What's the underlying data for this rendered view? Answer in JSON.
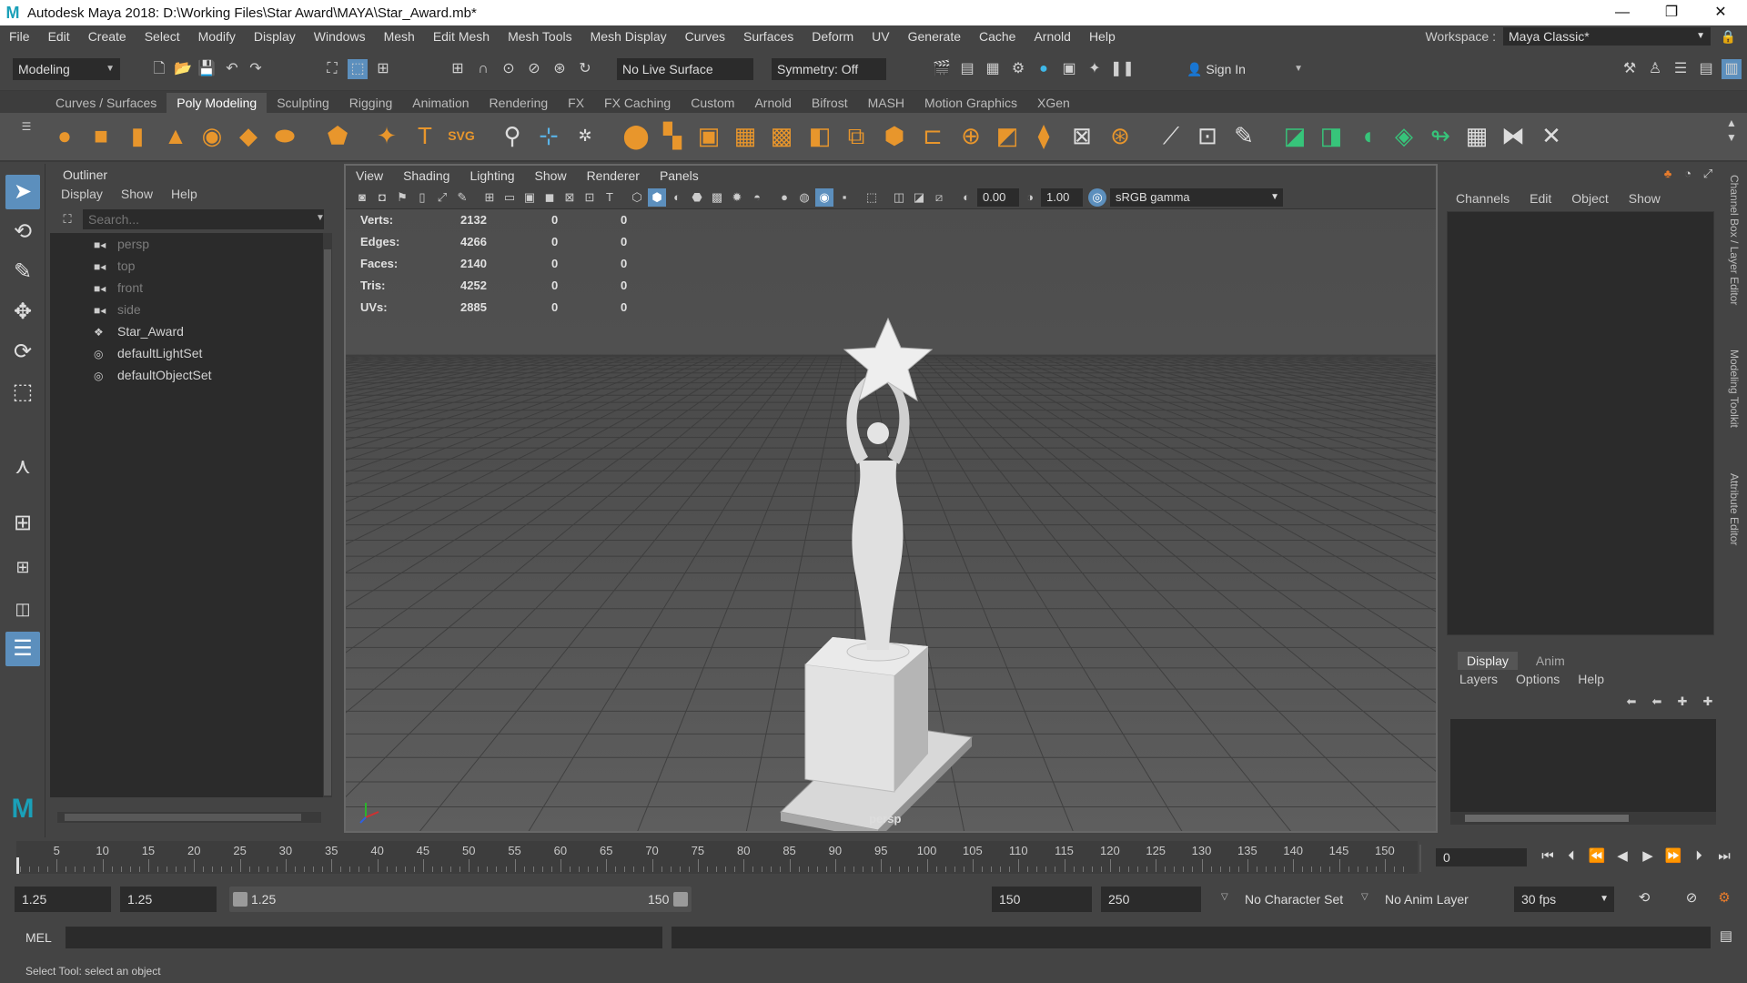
{
  "window": {
    "title": "Autodesk Maya 2018: D:\\Working Files\\Star Award\\MAYA\\Star_Award.mb*",
    "minimize": "—",
    "restore": "❐",
    "close": "✕"
  },
  "menubar": {
    "items": [
      "File",
      "Edit",
      "Create",
      "Select",
      "Modify",
      "Display",
      "Windows",
      "Mesh",
      "Edit Mesh",
      "Mesh Tools",
      "Mesh Display",
      "Curves",
      "Surfaces",
      "Deform",
      "UV",
      "Generate",
      "Cache",
      "Arnold",
      "Help"
    ],
    "workspace_label": "Workspace :",
    "workspace_value": "Maya Classic*"
  },
  "statusline": {
    "menuset": "Modeling",
    "live_surface": "No Live Surface",
    "symmetry": "Symmetry: Off",
    "sign_in": "Sign In"
  },
  "shelf": {
    "tabs": [
      "Curves / Surfaces",
      "Poly Modeling",
      "Sculpting",
      "Rigging",
      "Animation",
      "Rendering",
      "FX",
      "FX Caching",
      "Custom",
      "Arnold",
      "Bifrost",
      "MASH",
      "Motion Graphics",
      "XGen"
    ],
    "active_tab": "Poly Modeling",
    "text_icon": "T",
    "svg_icon": "SVG"
  },
  "outliner": {
    "title": "Outliner",
    "menu": [
      "Display",
      "Show",
      "Help"
    ],
    "search_placeholder": "Search...",
    "items": [
      {
        "label": "persp",
        "icon": "camera-icon",
        "dim": true
      },
      {
        "label": "top",
        "icon": "camera-icon",
        "dim": true
      },
      {
        "label": "front",
        "icon": "camera-icon",
        "dim": true
      },
      {
        "label": "side",
        "icon": "camera-icon",
        "dim": true
      },
      {
        "label": "Star_Award",
        "icon": "mesh-transform-icon",
        "dim": false
      },
      {
        "label": "defaultLightSet",
        "icon": "set-icon",
        "dim": false
      },
      {
        "label": "defaultObjectSet",
        "icon": "set-icon",
        "dim": false
      }
    ]
  },
  "viewport": {
    "menu": [
      "View",
      "Shading",
      "Lighting",
      "Show",
      "Renderer",
      "Panels"
    ],
    "exposure": "0.00",
    "gamma": "1.00",
    "color_space": "sRGB gamma",
    "camera_label": "persp",
    "hud": [
      {
        "label": "Verts:",
        "values": [
          "2132",
          "0",
          "0"
        ]
      },
      {
        "label": "Edges:",
        "values": [
          "4266",
          "0",
          "0"
        ]
      },
      {
        "label": "Faces:",
        "values": [
          "2140",
          "0",
          "0"
        ]
      },
      {
        "label": "Tris:",
        "values": [
          "4252",
          "0",
          "0"
        ]
      },
      {
        "label": "UVs:",
        "values": [
          "2885",
          "0",
          "0"
        ]
      }
    ]
  },
  "channelbox": {
    "menu": [
      "Channels",
      "Edit",
      "Object",
      "Show"
    ],
    "layer_tabs": [
      "Display",
      "Anim"
    ],
    "layer_menu": [
      "Layers",
      "Options",
      "Help"
    ],
    "side_tabs": [
      "Channel Box / Layer Editor",
      "Modeling Toolkit",
      "Attribute Editor"
    ]
  },
  "timeline": {
    "labels": [
      "5",
      "10",
      "15",
      "20",
      "25",
      "30",
      "35",
      "40",
      "45",
      "50",
      "55",
      "60",
      "65",
      "70",
      "75",
      "80",
      "85",
      "90",
      "95",
      "100",
      "105",
      "110",
      "115",
      "120",
      "125",
      "130",
      "135",
      "140",
      "145",
      "150"
    ],
    "current_time": "0"
  },
  "range": {
    "start": "1.25",
    "playback_start": "1.25",
    "slider_start": "1.25",
    "slider_end": "150",
    "playback_end": "150",
    "end": "250",
    "character_set": "No Character Set",
    "anim_layer": "No Anim Layer",
    "fps": "30 fps"
  },
  "command": {
    "label": "MEL"
  },
  "helpline": {
    "text": "Select Tool: select an object"
  }
}
